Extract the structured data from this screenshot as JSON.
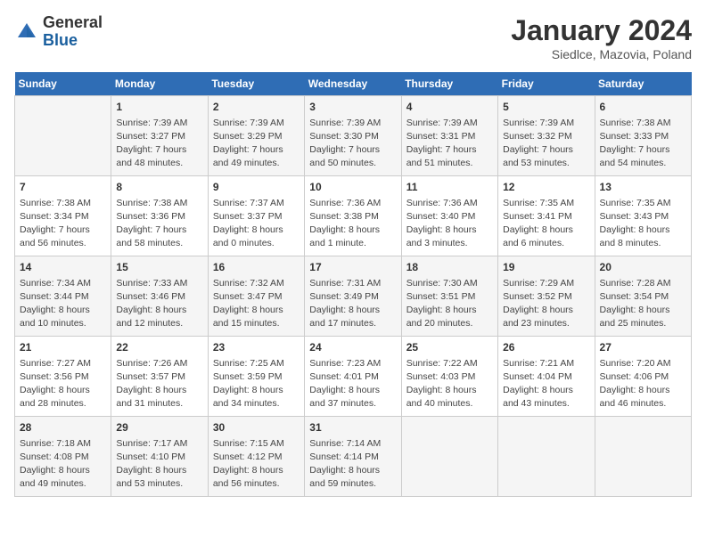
{
  "header": {
    "logo_general": "General",
    "logo_blue": "Blue",
    "title": "January 2024",
    "subtitle": "Siedlce, Mazovia, Poland"
  },
  "days_of_week": [
    "Sunday",
    "Monday",
    "Tuesday",
    "Wednesday",
    "Thursday",
    "Friday",
    "Saturday"
  ],
  "weeks": [
    [
      {
        "day": "",
        "info": ""
      },
      {
        "day": "1",
        "info": "Sunrise: 7:39 AM\nSunset: 3:27 PM\nDaylight: 7 hours\nand 48 minutes."
      },
      {
        "day": "2",
        "info": "Sunrise: 7:39 AM\nSunset: 3:29 PM\nDaylight: 7 hours\nand 49 minutes."
      },
      {
        "day": "3",
        "info": "Sunrise: 7:39 AM\nSunset: 3:30 PM\nDaylight: 7 hours\nand 50 minutes."
      },
      {
        "day": "4",
        "info": "Sunrise: 7:39 AM\nSunset: 3:31 PM\nDaylight: 7 hours\nand 51 minutes."
      },
      {
        "day": "5",
        "info": "Sunrise: 7:39 AM\nSunset: 3:32 PM\nDaylight: 7 hours\nand 53 minutes."
      },
      {
        "day": "6",
        "info": "Sunrise: 7:38 AM\nSunset: 3:33 PM\nDaylight: 7 hours\nand 54 minutes."
      }
    ],
    [
      {
        "day": "7",
        "info": "Sunrise: 7:38 AM\nSunset: 3:34 PM\nDaylight: 7 hours\nand 56 minutes."
      },
      {
        "day": "8",
        "info": "Sunrise: 7:38 AM\nSunset: 3:36 PM\nDaylight: 7 hours\nand 58 minutes."
      },
      {
        "day": "9",
        "info": "Sunrise: 7:37 AM\nSunset: 3:37 PM\nDaylight: 8 hours\nand 0 minutes."
      },
      {
        "day": "10",
        "info": "Sunrise: 7:36 AM\nSunset: 3:38 PM\nDaylight: 8 hours\nand 1 minute."
      },
      {
        "day": "11",
        "info": "Sunrise: 7:36 AM\nSunset: 3:40 PM\nDaylight: 8 hours\nand 3 minutes."
      },
      {
        "day": "12",
        "info": "Sunrise: 7:35 AM\nSunset: 3:41 PM\nDaylight: 8 hours\nand 6 minutes."
      },
      {
        "day": "13",
        "info": "Sunrise: 7:35 AM\nSunset: 3:43 PM\nDaylight: 8 hours\nand 8 minutes."
      }
    ],
    [
      {
        "day": "14",
        "info": "Sunrise: 7:34 AM\nSunset: 3:44 PM\nDaylight: 8 hours\nand 10 minutes."
      },
      {
        "day": "15",
        "info": "Sunrise: 7:33 AM\nSunset: 3:46 PM\nDaylight: 8 hours\nand 12 minutes."
      },
      {
        "day": "16",
        "info": "Sunrise: 7:32 AM\nSunset: 3:47 PM\nDaylight: 8 hours\nand 15 minutes."
      },
      {
        "day": "17",
        "info": "Sunrise: 7:31 AM\nSunset: 3:49 PM\nDaylight: 8 hours\nand 17 minutes."
      },
      {
        "day": "18",
        "info": "Sunrise: 7:30 AM\nSunset: 3:51 PM\nDaylight: 8 hours\nand 20 minutes."
      },
      {
        "day": "19",
        "info": "Sunrise: 7:29 AM\nSunset: 3:52 PM\nDaylight: 8 hours\nand 23 minutes."
      },
      {
        "day": "20",
        "info": "Sunrise: 7:28 AM\nSunset: 3:54 PM\nDaylight: 8 hours\nand 25 minutes."
      }
    ],
    [
      {
        "day": "21",
        "info": "Sunrise: 7:27 AM\nSunset: 3:56 PM\nDaylight: 8 hours\nand 28 minutes."
      },
      {
        "day": "22",
        "info": "Sunrise: 7:26 AM\nSunset: 3:57 PM\nDaylight: 8 hours\nand 31 minutes."
      },
      {
        "day": "23",
        "info": "Sunrise: 7:25 AM\nSunset: 3:59 PM\nDaylight: 8 hours\nand 34 minutes."
      },
      {
        "day": "24",
        "info": "Sunrise: 7:23 AM\nSunset: 4:01 PM\nDaylight: 8 hours\nand 37 minutes."
      },
      {
        "day": "25",
        "info": "Sunrise: 7:22 AM\nSunset: 4:03 PM\nDaylight: 8 hours\nand 40 minutes."
      },
      {
        "day": "26",
        "info": "Sunrise: 7:21 AM\nSunset: 4:04 PM\nDaylight: 8 hours\nand 43 minutes."
      },
      {
        "day": "27",
        "info": "Sunrise: 7:20 AM\nSunset: 4:06 PM\nDaylight: 8 hours\nand 46 minutes."
      }
    ],
    [
      {
        "day": "28",
        "info": "Sunrise: 7:18 AM\nSunset: 4:08 PM\nDaylight: 8 hours\nand 49 minutes."
      },
      {
        "day": "29",
        "info": "Sunrise: 7:17 AM\nSunset: 4:10 PM\nDaylight: 8 hours\nand 53 minutes."
      },
      {
        "day": "30",
        "info": "Sunrise: 7:15 AM\nSunset: 4:12 PM\nDaylight: 8 hours\nand 56 minutes."
      },
      {
        "day": "31",
        "info": "Sunrise: 7:14 AM\nSunset: 4:14 PM\nDaylight: 8 hours\nand 59 minutes."
      },
      {
        "day": "",
        "info": ""
      },
      {
        "day": "",
        "info": ""
      },
      {
        "day": "",
        "info": ""
      }
    ]
  ]
}
